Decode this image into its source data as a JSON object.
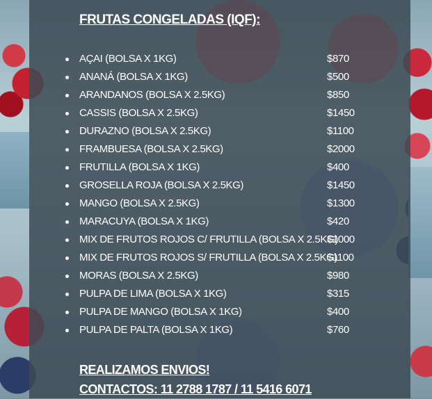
{
  "heading": "FRUTAS CONGELADAS (IQF):",
  "items": [
    {
      "name": "AÇAI (BOLSA X 1KG)",
      "price": "$870"
    },
    {
      "name": "ANANÁ (BOLSA X 1KG)",
      "price": "$500"
    },
    {
      "name": "ARANDANOS (BOLSA X 2.5KG)",
      "price": "$850"
    },
    {
      "name": "CASSIS (BOLSA X 2.5KG)",
      "price": "$1450"
    },
    {
      "name": "DURAZNO (BOLSA X 2.5KG)",
      "price": "$1100"
    },
    {
      "name": "FRAMBUESA (BOLSA X 2.5KG)",
      "price": "$2000"
    },
    {
      "name": "FRUTILLA (BOLSA X 1KG)",
      "price": "$400"
    },
    {
      "name": "GROSELLA ROJA (BOLSA X 2.5KG)",
      "price": "$1450"
    },
    {
      "name": "MANGO (BOLSA X 2.5KG)",
      "price": "$1300"
    },
    {
      "name": "MARACUYA (BOLSA X 1KG)",
      "price": "$420"
    },
    {
      "name": "MIX DE FRUTOS ROJOS C/ FRUTILLA (BOLSA X 2.5KG)",
      "price": "$1000"
    },
    {
      "name": "MIX DE FRUTOS ROJOS S/ FRUTILLA (BOLSA X 2.5KG)",
      "price": "$1100"
    },
    {
      "name": "MORAS (BOLSA X 2.5KG)",
      "price": "$980"
    },
    {
      "name": "PULPA DE LIMA (BOLSA X 1KG)",
      "price": "$315"
    },
    {
      "name": "PULPA DE MANGO (BOLSA X 1KG)",
      "price": "$400"
    },
    {
      "name": "PULPA DE PALTA (BOLSA X 1KG)",
      "price": "$760"
    }
  ],
  "footer": {
    "shipping": "REALIZAMOS ENVIOS!",
    "contacts": "CONTACTOS: 11 2788 1787 / 11 5416 6071"
  },
  "colors": {
    "text": "#ffffff",
    "panel": "#3c4a54"
  }
}
